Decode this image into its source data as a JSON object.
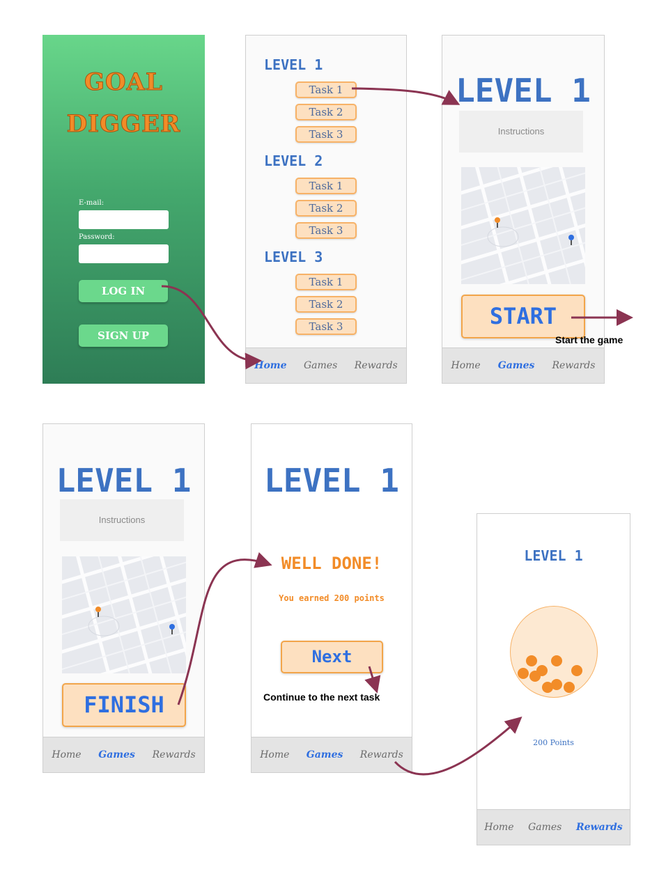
{
  "login": {
    "title_line1": "GOAL",
    "title_line2": "DIGGER",
    "email_label": "E-mail:",
    "password_label": "Password:",
    "login_label": "LOG IN",
    "signup_label": "SIGN UP"
  },
  "nav": {
    "home": "Home",
    "games": "Games",
    "rewards": "Rewards"
  },
  "home": {
    "levels": [
      {
        "title": "LEVEL 1",
        "tasks": [
          "Task 1",
          "Task 2",
          "Task 3"
        ]
      },
      {
        "title": "LEVEL 2",
        "tasks": [
          "Task 1",
          "Task 2",
          "Task 3"
        ]
      },
      {
        "title": "LEVEL 3",
        "tasks": [
          "Task 1",
          "Task 2",
          "Task 3"
        ]
      }
    ]
  },
  "game": {
    "level_title": "LEVEL 1",
    "instructions": "Instructions",
    "start_label": "START",
    "finish_label": "FINISH"
  },
  "done": {
    "level_title": "LEVEL 1",
    "heading": "WELL DONE!",
    "points_msg": "You earned 200 points",
    "next_label": "Next"
  },
  "rewards": {
    "level_title": "LEVEL 1",
    "points_label": "200 Points"
  },
  "annotations": {
    "start_caption": "Start the game",
    "next_caption": "Continue to the next task"
  },
  "colors": {
    "arrow": "#8b3452",
    "accent_blue": "#3d72c2",
    "accent_orange": "#f28c28",
    "login_gradient_top": "#68d68a",
    "login_gradient_bottom": "#2e7d56"
  }
}
